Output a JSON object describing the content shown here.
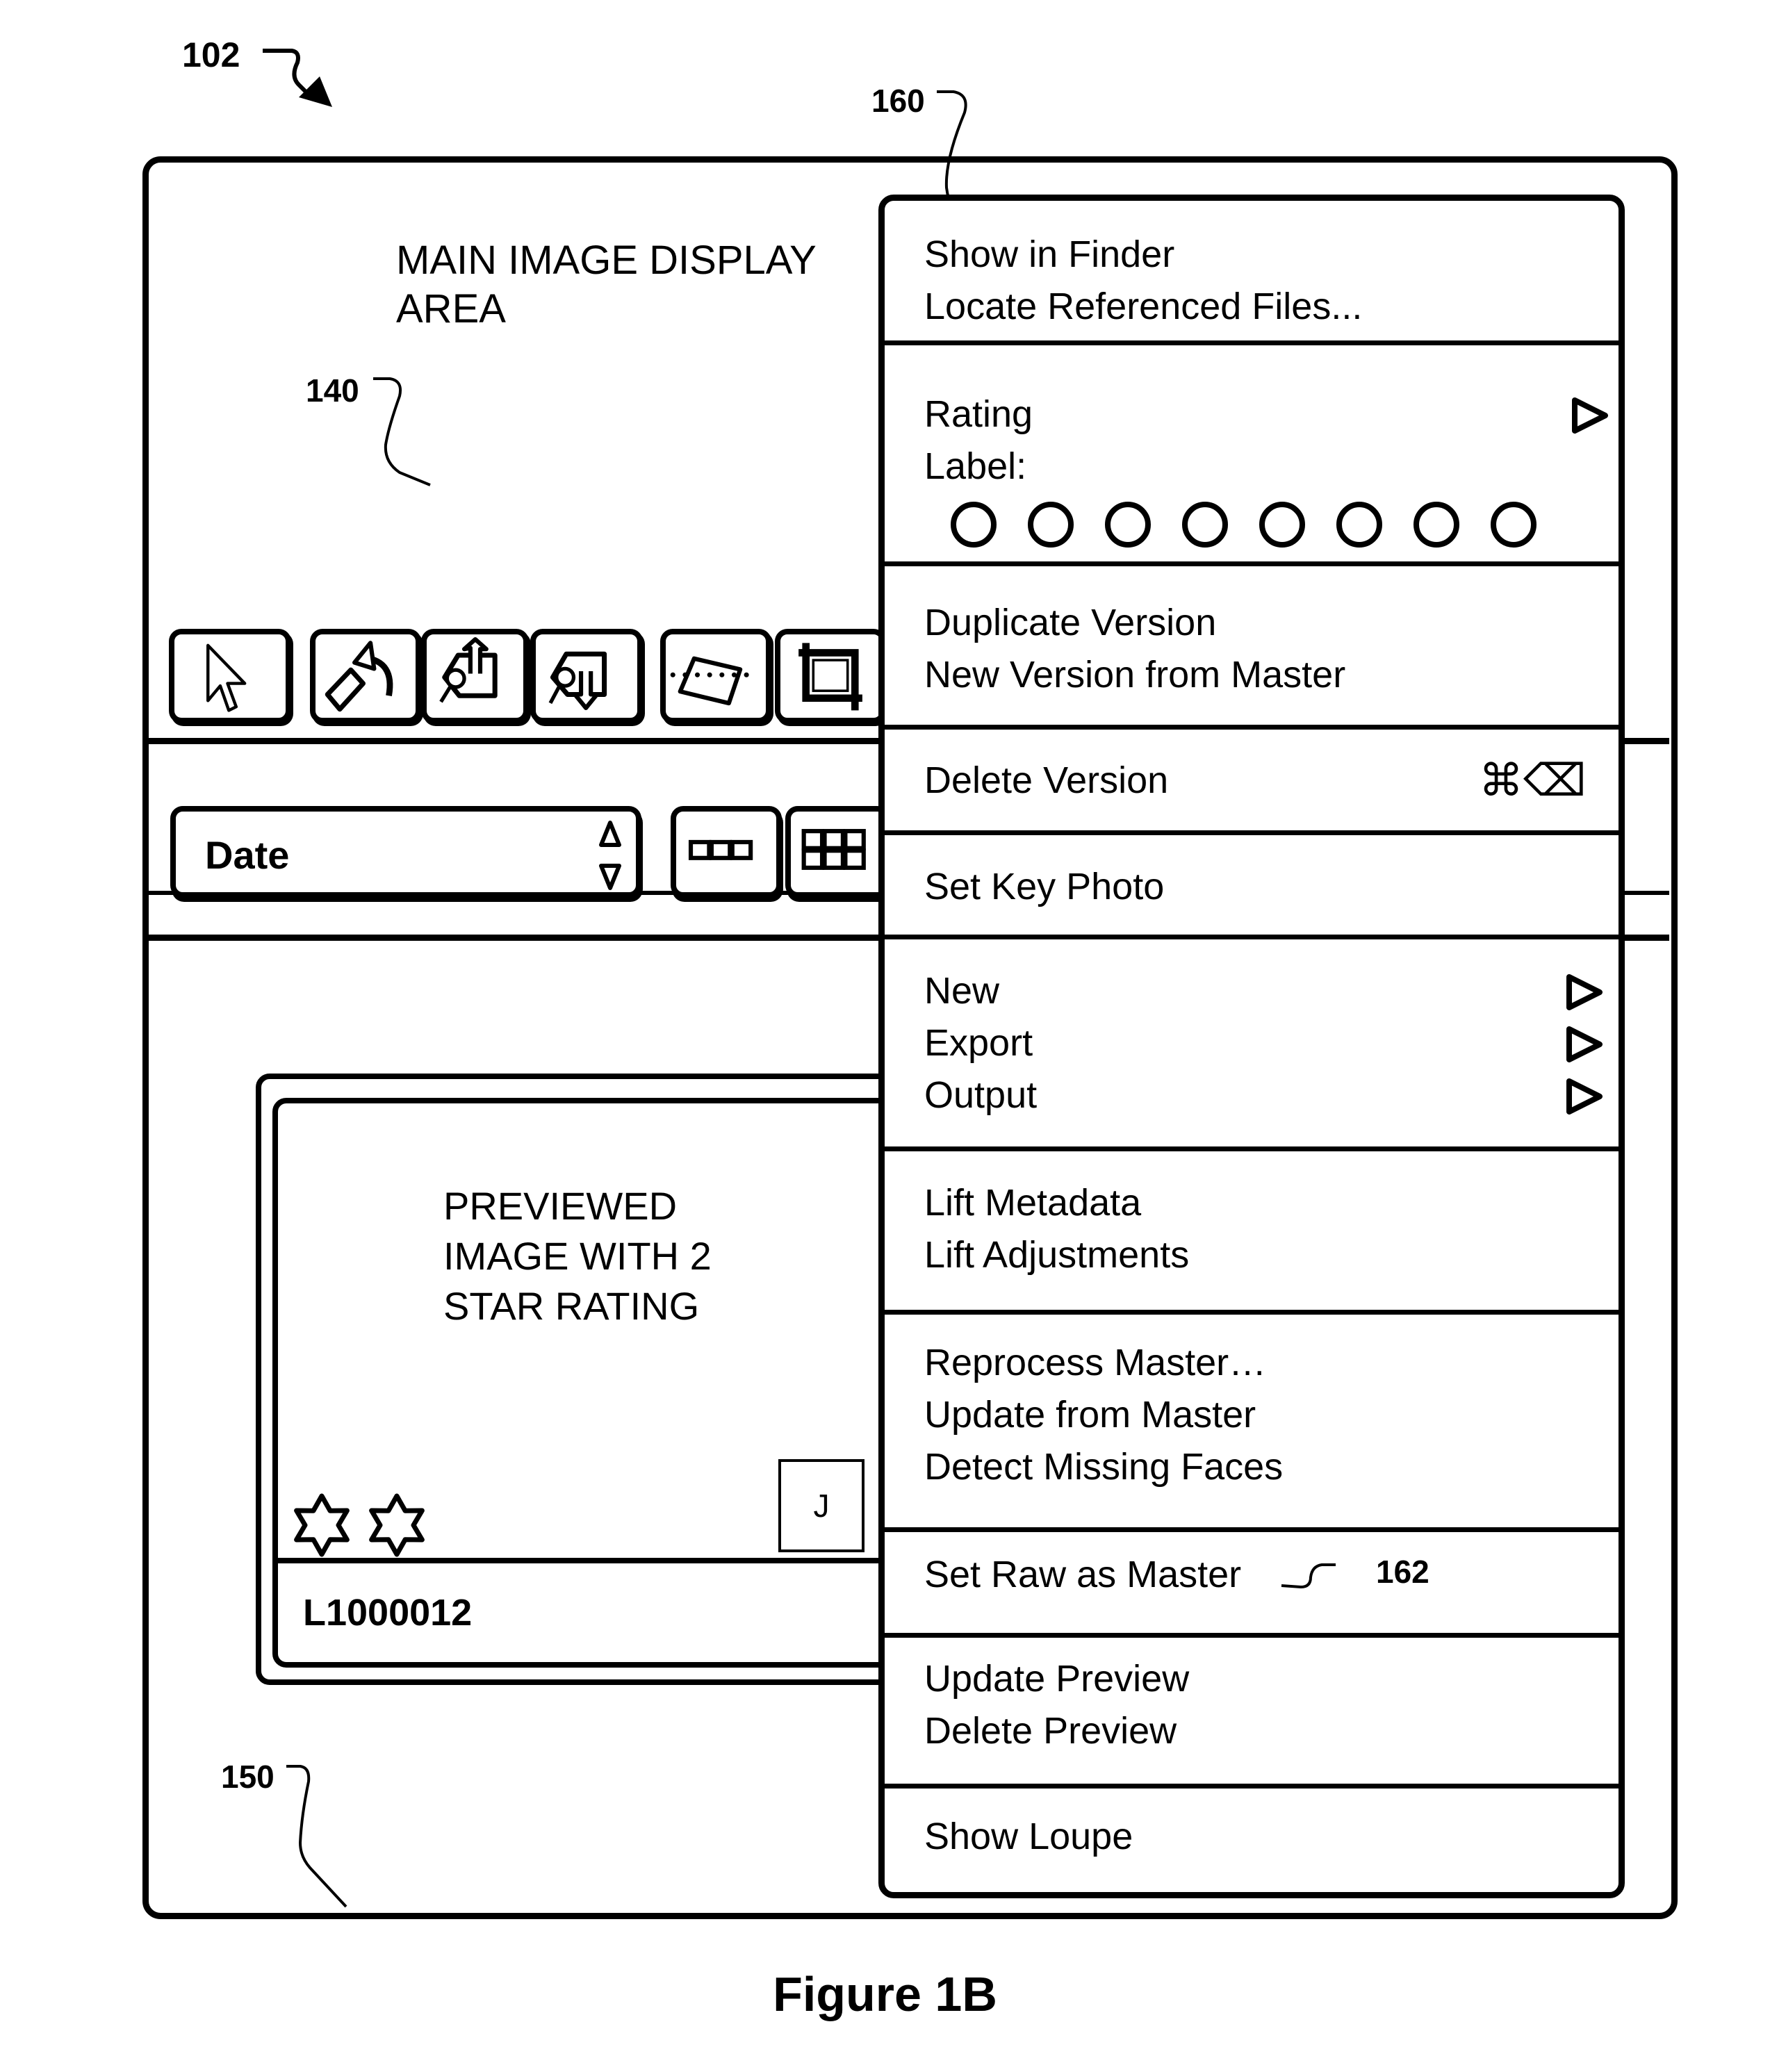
{
  "figure": {
    "caption": "Figure 1B",
    "reference_numerals": {
      "window": "102",
      "main_display": "140",
      "browser": "150",
      "context_menu": "160",
      "set_raw_item": "162"
    }
  },
  "main_display": {
    "label_line1": "MAIN IMAGE DISPLAY",
    "label_line2": "AREA"
  },
  "toolbar": {
    "tools": [
      {
        "name": "pointer-tool",
        "icon": "arrow-pointer-icon"
      },
      {
        "name": "rotate-tool",
        "icon": "rotate-icon"
      },
      {
        "name": "lift-tool",
        "icon": "lift-eyedropper-up-icon"
      },
      {
        "name": "stamp-tool",
        "icon": "stamp-eyedropper-down-icon"
      },
      {
        "name": "straighten-tool",
        "icon": "straighten-icon"
      },
      {
        "name": "crop-tool",
        "icon": "crop-icon"
      }
    ]
  },
  "browser_controls": {
    "sort_select": {
      "value": "Date",
      "icon": "up-down-stepper-icon"
    },
    "view_buttons": [
      {
        "name": "filmstrip-view",
        "icon": "filmstrip-icon"
      },
      {
        "name": "grid-view",
        "icon": "grid-icon"
      }
    ]
  },
  "thumbnail": {
    "preview_line1": "PREVIEWED",
    "preview_line2": "IMAGE WITH 2",
    "preview_line3": "STAR RATING",
    "rating_stars": 2,
    "badge": "J",
    "filename": "L1000012"
  },
  "context_menu": {
    "groups": [
      {
        "items": [
          {
            "label": "Show in Finder"
          },
          {
            "label": "Locate Referenced Files..."
          }
        ]
      },
      {
        "items": [
          {
            "label": "Rating",
            "submenu": true
          },
          {
            "label": "Label:"
          }
        ],
        "label_swatches": 8
      },
      {
        "items": [
          {
            "label": "Duplicate Version"
          },
          {
            "label": "New Version from Master"
          }
        ]
      },
      {
        "items": [
          {
            "label": "Delete Version",
            "shortcut": "⌘⌫"
          }
        ]
      },
      {
        "items": [
          {
            "label": "Set Key Photo"
          }
        ]
      },
      {
        "items": [
          {
            "label": "New",
            "submenu": true
          },
          {
            "label": "Export",
            "submenu": true
          },
          {
            "label": "Output",
            "submenu": true
          }
        ]
      },
      {
        "items": [
          {
            "label": "Lift Metadata"
          },
          {
            "label": "Lift Adjustments"
          }
        ]
      },
      {
        "items": [
          {
            "label": "Reprocess Master…"
          },
          {
            "label": "Update from Master"
          },
          {
            "label": "Detect Missing Faces"
          }
        ]
      },
      {
        "items": [
          {
            "label": "Set Raw as Master"
          }
        ]
      },
      {
        "items": [
          {
            "label": "Update Preview"
          },
          {
            "label": "Delete Preview"
          }
        ]
      },
      {
        "items": [
          {
            "label": "Show Loupe"
          }
        ]
      }
    ]
  }
}
